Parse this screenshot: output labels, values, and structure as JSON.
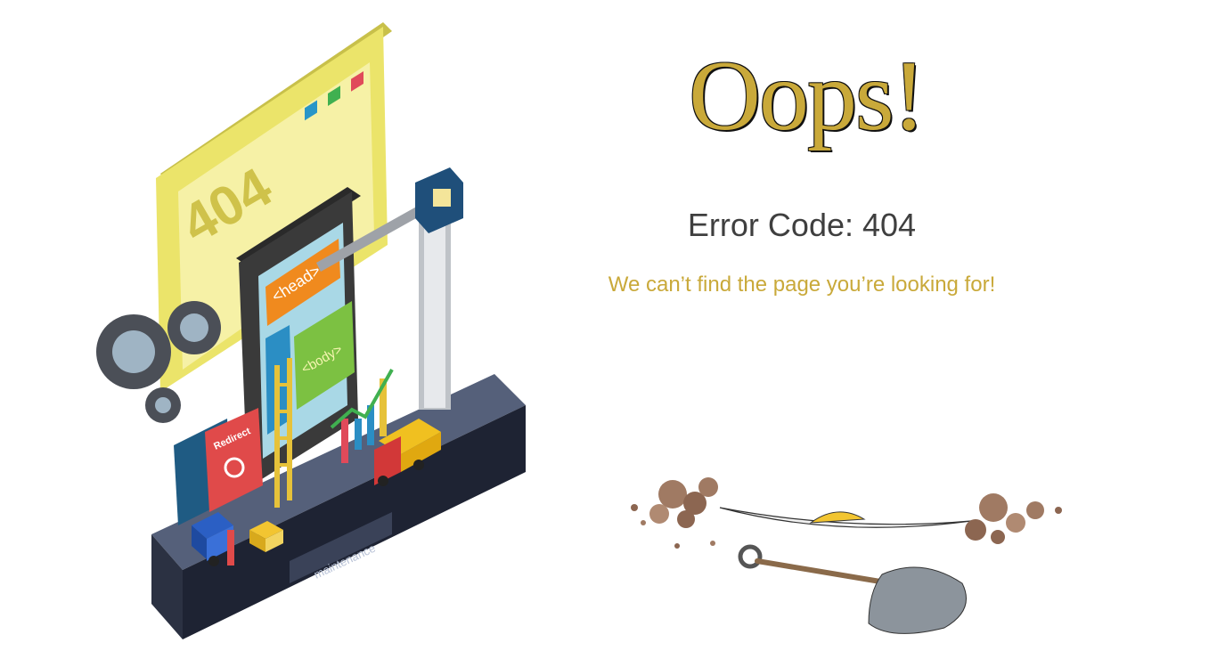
{
  "illustration": {
    "screen_code": "404",
    "head_tag": "<head>",
    "body_tag": "<body>",
    "redirect_label": "Redirect",
    "maintenance_label": "maintenance"
  },
  "main": {
    "title": "Oops!",
    "error_code": "Error Code: 404",
    "message": "We can’t find the page you’re looking for!"
  },
  "colors": {
    "accent_gold": "#c9a93a",
    "text_dark": "#3f3f3f",
    "platform": "#4a5568",
    "screen_yellow": "#f2ec74"
  }
}
